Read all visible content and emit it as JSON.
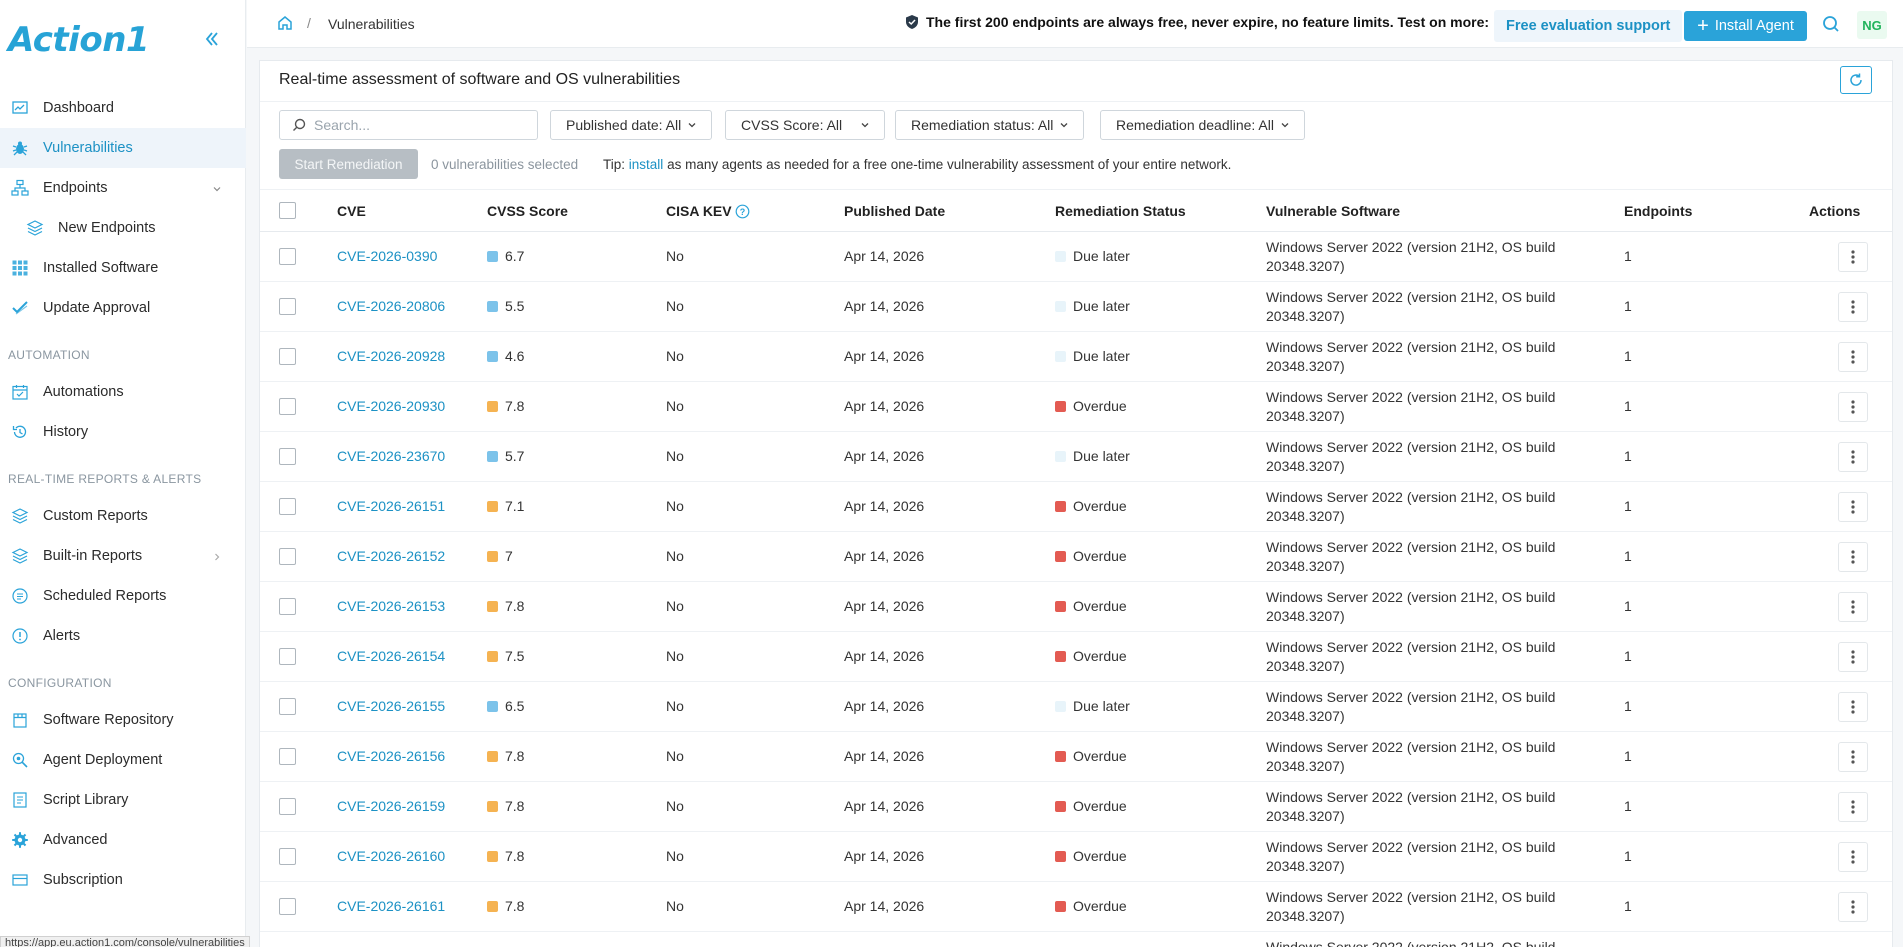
{
  "brand": {
    "logo_text": "Action1"
  },
  "sidebar": {
    "items": [
      {
        "label": "Dashboard",
        "icon": "dashboard-icon"
      },
      {
        "label": "Vulnerabilities",
        "icon": "bug-icon",
        "active": true
      },
      {
        "label": "Endpoints",
        "icon": "network-icon",
        "expand": "chevron-down-icon"
      },
      {
        "label": "New Endpoints",
        "icon": "layers-icon",
        "sub": true
      }
    ],
    "items2": [
      {
        "label": "Installed Software",
        "icon": "grid-icon"
      },
      {
        "label": "Update Approval",
        "icon": "check-icon"
      }
    ],
    "section_automation": "AUTOMATION",
    "automation": [
      {
        "label": "Automations",
        "icon": "calendar-check-icon"
      },
      {
        "label": "History",
        "icon": "history-icon"
      }
    ],
    "section_reports": "REAL-TIME REPORTS & ALERTS",
    "reports": [
      {
        "label": "Custom Reports",
        "icon": "layers-icon"
      },
      {
        "label": "Built-in Reports",
        "icon": "layers-icon",
        "expand": "chevron-right-icon"
      },
      {
        "label": "Scheduled Reports",
        "icon": "schedule-icon"
      },
      {
        "label": "Alerts",
        "icon": "alert-icon"
      }
    ],
    "section_config": "CONFIGURATION",
    "config": [
      {
        "label": "Software Repository",
        "icon": "package-icon"
      },
      {
        "label": "Agent Deployment",
        "icon": "search-gear-icon"
      },
      {
        "label": "Script Library",
        "icon": "script-icon"
      },
      {
        "label": "Advanced",
        "icon": "gear-icon"
      },
      {
        "label": "Subscription",
        "icon": "subscription-icon"
      }
    ]
  },
  "header": {
    "breadcrumb_sep": "/",
    "breadcrumb_current": "Vulnerabilities",
    "promo_text": "The first 200 endpoints are always free, never expire, no feature limits. Test on more:",
    "eval_button": "Free evaluation support",
    "install_button": "Install Agent",
    "avatar_initials": "NG"
  },
  "main": {
    "title": "Real-time assessment of software and OS vulnerabilities",
    "search_placeholder": "Search...",
    "filters": {
      "published": "Published date: All",
      "cvss": "CVSS Score: All",
      "remediation": "Remediation status: All",
      "deadline": "Remediation deadline: All"
    },
    "start_remediation": "Start Remediation",
    "selected_count": "0 vulnerabilities selected",
    "tip_prefix": "Tip:",
    "tip_link": "install",
    "tip_suffix": "as many agents as needed for a free one-time vulnerability assessment of your entire network."
  },
  "table": {
    "columns": {
      "cve": "CVE",
      "cvss": "CVSS Score",
      "kev": "CISA KEV",
      "published": "Published Date",
      "status": "Remediation Status",
      "software": "Vulnerable Software",
      "endpoints": "Endpoints",
      "actions": "Actions"
    },
    "rows": [
      {
        "cve": "CVE-2026-0390",
        "score": "6.7",
        "sev": "medium",
        "kev": "No",
        "date": "Apr 14, 2026",
        "status": "Due later",
        "software": "Windows Server 2022 (version 21H2, OS build 20348.3207)",
        "endpoints": "1"
      },
      {
        "cve": "CVE-2026-20806",
        "score": "5.5",
        "sev": "medium",
        "kev": "No",
        "date": "Apr 14, 2026",
        "status": "Due later",
        "software": "Windows Server 2022 (version 21H2, OS build 20348.3207)",
        "endpoints": "1"
      },
      {
        "cve": "CVE-2026-20928",
        "score": "4.6",
        "sev": "medium",
        "kev": "No",
        "date": "Apr 14, 2026",
        "status": "Due later",
        "software": "Windows Server 2022 (version 21H2, OS build 20348.3207)",
        "endpoints": "1"
      },
      {
        "cve": "CVE-2026-20930",
        "score": "7.8",
        "sev": "high",
        "kev": "No",
        "date": "Apr 14, 2026",
        "status": "Overdue",
        "software": "Windows Server 2022 (version 21H2, OS build 20348.3207)",
        "endpoints": "1"
      },
      {
        "cve": "CVE-2026-23670",
        "score": "5.7",
        "sev": "medium",
        "kev": "No",
        "date": "Apr 14, 2026",
        "status": "Due later",
        "software": "Windows Server 2022 (version 21H2, OS build 20348.3207)",
        "endpoints": "1"
      },
      {
        "cve": "CVE-2026-26151",
        "score": "7.1",
        "sev": "high",
        "kev": "No",
        "date": "Apr 14, 2026",
        "status": "Overdue",
        "software": "Windows Server 2022 (version 21H2, OS build 20348.3207)",
        "endpoints": "1"
      },
      {
        "cve": "CVE-2026-26152",
        "score": "7",
        "sev": "high",
        "kev": "No",
        "date": "Apr 14, 2026",
        "status": "Overdue",
        "software": "Windows Server 2022 (version 21H2, OS build 20348.3207)",
        "endpoints": "1"
      },
      {
        "cve": "CVE-2026-26153",
        "score": "7.8",
        "sev": "high",
        "kev": "No",
        "date": "Apr 14, 2026",
        "status": "Overdue",
        "software": "Windows Server 2022 (version 21H2, OS build 20348.3207)",
        "endpoints": "1"
      },
      {
        "cve": "CVE-2026-26154",
        "score": "7.5",
        "sev": "high",
        "kev": "No",
        "date": "Apr 14, 2026",
        "status": "Overdue",
        "software": "Windows Server 2022 (version 21H2, OS build 20348.3207)",
        "endpoints": "1"
      },
      {
        "cve": "CVE-2026-26155",
        "score": "6.5",
        "sev": "medium",
        "kev": "No",
        "date": "Apr 14, 2026",
        "status": "Due later",
        "software": "Windows Server 2022 (version 21H2, OS build 20348.3207)",
        "endpoints": "1"
      },
      {
        "cve": "CVE-2026-26156",
        "score": "7.8",
        "sev": "high",
        "kev": "No",
        "date": "Apr 14, 2026",
        "status": "Overdue",
        "software": "Windows Server 2022 (version 21H2, OS build 20348.3207)",
        "endpoints": "1"
      },
      {
        "cve": "CVE-2026-26159",
        "score": "7.8",
        "sev": "high",
        "kev": "No",
        "date": "Apr 14, 2026",
        "status": "Overdue",
        "software": "Windows Server 2022 (version 21H2, OS build 20348.3207)",
        "endpoints": "1"
      },
      {
        "cve": "CVE-2026-26160",
        "score": "7.8",
        "sev": "high",
        "kev": "No",
        "date": "Apr 14, 2026",
        "status": "Overdue",
        "software": "Windows Server 2022 (version 21H2, OS build 20348.3207)",
        "endpoints": "1"
      },
      {
        "cve": "CVE-2026-26161",
        "score": "7.8",
        "sev": "high",
        "kev": "No",
        "date": "Apr 14, 2026",
        "status": "Overdue",
        "software": "Windows Server 2022 (version 21H2, OS build 20348.3207)",
        "endpoints": "1"
      },
      {
        "cve": "",
        "score": "",
        "sev": "",
        "kev": "",
        "date": "",
        "status": "",
        "software": "Windows Server 2022 (version 21H2, OS build",
        "endpoints": ""
      }
    ]
  },
  "colors": {
    "accent": "#2aa3d9",
    "link": "#1c91c4",
    "severity_medium": "#7cc3ea",
    "severity_high": "#f5b352",
    "status_overdue": "#e35b52",
    "status_due_later": "#e8f4fa"
  },
  "status_bar_url": "https://app.eu.action1.com/console/vulnerabilities"
}
